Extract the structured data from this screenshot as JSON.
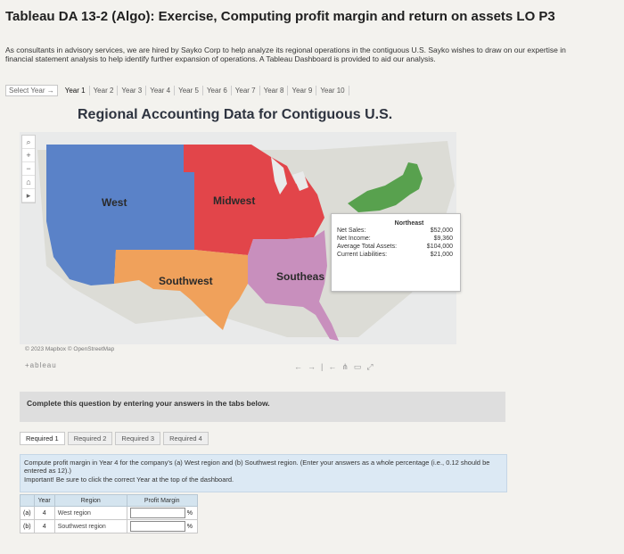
{
  "header": {
    "title": "Tableau DA 13-2 (Algo): Exercise, Computing profit margin and return on assets LO P3",
    "intro": "As consultants in advisory services, we are hired by Sayko Corp to help analyze its regional operations in the contiguous U.S. Sayko wishes to draw on our expertise in financial statement analysis to help identify further expansion of operations. A Tableau Dashboard is provided to aid our analysis."
  },
  "year_selector": {
    "label": "Select Year",
    "years": [
      "Year 1",
      "Year 2",
      "Year 3",
      "Year 4",
      "Year 5",
      "Year 6",
      "Year 7",
      "Year 8",
      "Year 9",
      "Year 10"
    ]
  },
  "dashboard": {
    "heading": "Regional Accounting Data for Contiguous U.S.",
    "regions": {
      "west": {
        "label": "West",
        "color": "#5a82c8"
      },
      "midwest": {
        "label": "Midwest",
        "color": "#e2454a"
      },
      "southwest": {
        "label": "Southwest",
        "color": "#f0a15b"
      },
      "southeast": {
        "label": "Southeas",
        "color": "#c88fbd"
      },
      "northeast": {
        "label": "",
        "color": "#58a14e"
      }
    },
    "tooltip": {
      "region": "Northeast",
      "rows": [
        {
          "label": "Net Sales:",
          "value": "$52,000"
        },
        {
          "label": "Net Income:",
          "value": "$9,360"
        },
        {
          "label": "Average Total Assets:",
          "value": "$104,000"
        },
        {
          "label": "Current Liabilities:",
          "value": "$21,000"
        }
      ]
    },
    "attribution": "© 2023 Mapbox © OpenStreetMap",
    "brand": "+ableau"
  },
  "question": {
    "prompt": "Complete this question by entering your answers in the tabs below.",
    "tabs": [
      "Required 1",
      "Required 2",
      "Required 3",
      "Required 4"
    ],
    "text": "Compute profit margin in Year 4 for the company's (a) West region and (b) Southwest region. (Enter your answers as a whole percentage (i.e., 0.12 should be entered as 12).)",
    "note": "Important! Be sure to click the correct Year at the top of the dashboard.",
    "table": {
      "headers": [
        "Year",
        "Region",
        "Profit Margin"
      ],
      "rows": [
        {
          "id": "(a)",
          "year": "4",
          "region": "West region",
          "unit": "%"
        },
        {
          "id": "(b)",
          "year": "4",
          "region": "Southwest region",
          "unit": "%"
        }
      ]
    }
  }
}
